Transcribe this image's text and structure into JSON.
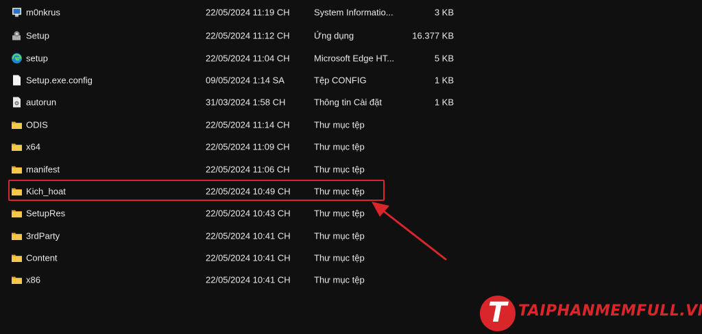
{
  "files": [
    {
      "icon": "system-info-file-icon",
      "name": "m0nkrus",
      "date": "22/05/2024 11:19 CH",
      "type": "System Informatio...",
      "size": "3 KB"
    },
    {
      "icon": "setup-app-icon",
      "name": "Setup",
      "date": "22/05/2024 11:12 CH",
      "type": "Ứng dụng",
      "size": "16.377 KB"
    },
    {
      "icon": "edge-icon",
      "name": "setup",
      "date": "22/05/2024 11:04 CH",
      "type": "Microsoft Edge HT...",
      "size": "5 KB"
    },
    {
      "icon": "document-icon",
      "name": "Setup.exe.config",
      "date": "09/05/2024 1:14 SA",
      "type": "Tệp CONFIG",
      "size": "1 KB"
    },
    {
      "icon": "settings-file-icon",
      "name": "autorun",
      "date": "31/03/2024 1:58 CH",
      "type": "Thông tin Cài đặt",
      "size": "1 KB"
    },
    {
      "icon": "folder-icon",
      "name": "ODIS",
      "date": "22/05/2024 11:14 CH",
      "type": "Thư mục tệp",
      "size": ""
    },
    {
      "icon": "folder-icon",
      "name": "x64",
      "date": "22/05/2024 11:09 CH",
      "type": "Thư mục tệp",
      "size": ""
    },
    {
      "icon": "folder-icon",
      "name": "manifest",
      "date": "22/05/2024 11:06 CH",
      "type": "Thư mục tệp",
      "size": ""
    },
    {
      "icon": "folder-icon",
      "name": "Kich_hoat",
      "date": "22/05/2024 10:49 CH",
      "type": "Thư mục tệp",
      "size": ""
    },
    {
      "icon": "folder-icon",
      "name": "SetupRes",
      "date": "22/05/2024 10:43 CH",
      "type": "Thư mục tệp",
      "size": ""
    },
    {
      "icon": "folder-icon",
      "name": "3rdParty",
      "date": "22/05/2024 10:41 CH",
      "type": "Thư mục tệp",
      "size": ""
    },
    {
      "icon": "folder-icon",
      "name": "Content",
      "date": "22/05/2024 10:41 CH",
      "type": "Thư mục tệp",
      "size": ""
    },
    {
      "icon": "folder-icon",
      "name": "x86",
      "date": "22/05/2024 10:41 CH",
      "type": "Thư mục tệp",
      "size": ""
    }
  ],
  "highlighted_row": "Kich_hoat",
  "watermark": {
    "logo_letter": "T",
    "text": "TAIPHANMEMFULL.VN"
  },
  "colors": {
    "background": "#101010",
    "text": "#e8e8e8",
    "accent_red": "#d8262a",
    "folder_yellow": "#f2c94c"
  }
}
